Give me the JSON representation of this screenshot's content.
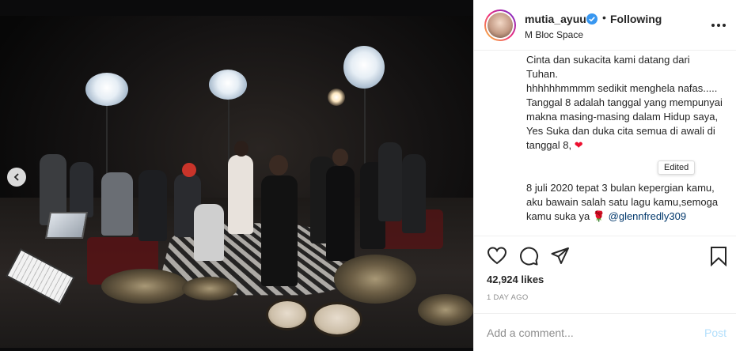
{
  "post": {
    "username": "mutia_ayuu",
    "verified_icon": "verified-badge-icon",
    "separator": "•",
    "follow_status": "Following",
    "location": "M Bloc Space"
  },
  "caption": {
    "lines": [
      "Cinta dan sukacita kami datang dari Tuhan.",
      "hhhhhhmmmm sedikit menghela nafas..... Tanggal 8 adalah tanggal yang mempunyai makna masing-masing dalam Hidup saya, Yes Suka dan duka cita semua di awali di tanggal 8,",
      "8 juli 2020 tepat 3 bulan kepergian kamu, aku bawain salah satu lagu kamu,semoga kamu suka ya"
    ],
    "heart": "❤",
    "rose": "🌹",
    "mention": "@glennfredly309",
    "edited_label": "Edited"
  },
  "actions": {
    "like_icon": "heart-outline-icon",
    "comment_icon": "comment-bubble-icon",
    "share_icon": "paper-plane-icon",
    "save_icon": "bookmark-icon",
    "likes": "42,924 likes",
    "time_ago": "1 DAY AGO"
  },
  "comment": {
    "placeholder": "Add a comment...",
    "post_label": "Post"
  },
  "colors": {
    "link": "#00376b",
    "verified": "#3897f0",
    "post_disabled": "#b2dffc",
    "muted": "#8e8e8e"
  }
}
